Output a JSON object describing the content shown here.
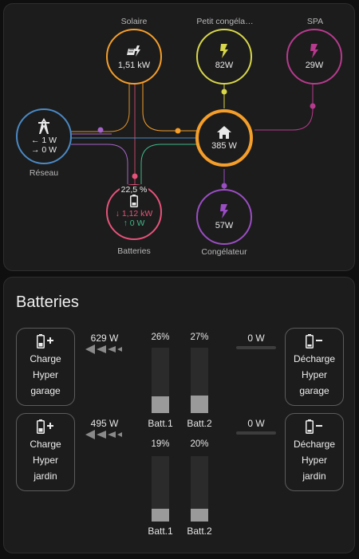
{
  "flow": {
    "solar": {
      "label": "Solaire",
      "value": "1,51 kW",
      "color": "#f59e2a"
    },
    "freezer_small": {
      "label": "Petit congéla…",
      "value": "82W",
      "color": "#d8d64a"
    },
    "spa": {
      "label": "SPA",
      "value": "29W",
      "color": "#b83a8e"
    },
    "grid": {
      "label": "Réseau",
      "in": "← 1 W",
      "out": "→ 0 W",
      "color": "#4b89c4",
      "in_color": "#a564c8",
      "out_color": "#6c8fd8"
    },
    "home": {
      "value": "385 W",
      "color": "#f59e2a"
    },
    "battery": {
      "label": "Batteries",
      "soc": "22,5 %",
      "out": "↓ 1,12 kW",
      "in": "↑ 0 W",
      "color": "#e7527a",
      "in_color": "#3fb98a"
    },
    "freezer": {
      "label": "Congélateur",
      "value": "57W",
      "color": "#9b4dc4"
    },
    "icons": {
      "solar": "solar-panel-icon",
      "freezer_small": "flash-icon",
      "spa": "flash-icon",
      "grid": "transmission-tower-icon",
      "home": "home-icon",
      "battery": "battery-icon",
      "freezer": "flash-icon"
    }
  },
  "batteries": {
    "title": "Batteries",
    "rows": [
      {
        "charge": {
          "line1": "Charge",
          "line2": "Hyper",
          "line3": "garage"
        },
        "charge_power": "629 W",
        "batts": [
          {
            "pct": "26%",
            "level": 0.26,
            "name": "Batt.1"
          },
          {
            "pct": "27%",
            "level": 0.27,
            "name": "Batt.2"
          }
        ],
        "discharge_power": "0 W",
        "discharge": {
          "line1": "Décharge",
          "line2": "Hyper",
          "line3": "garage"
        }
      },
      {
        "charge": {
          "line1": "Charge",
          "line2": "Hyper",
          "line3": "jardin"
        },
        "charge_power": "495 W",
        "batts": [
          {
            "pct": "19%",
            "level": 0.19,
            "name": "Batt.1"
          },
          {
            "pct": "20%",
            "level": 0.2,
            "name": "Batt.2"
          }
        ],
        "discharge_power": "0 W",
        "discharge": {
          "line1": "Décharge",
          "line2": "Hyper",
          "line3": "jardin"
        }
      }
    ]
  }
}
